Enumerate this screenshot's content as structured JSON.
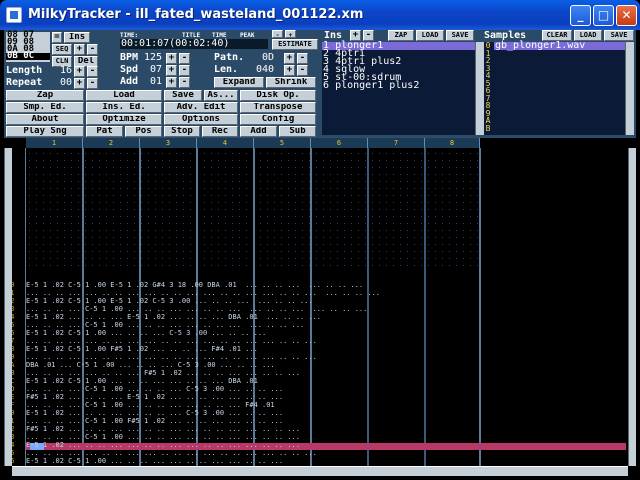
{
  "window": {
    "title": "MilkyTracker - ill_fated_wasteland_001122.xm",
    "minimize": "_",
    "maximize": "□",
    "close": "✕"
  },
  "orderlist": {
    "entries": [
      "08 07",
      "09 08",
      "0A 08",
      "0B 0C"
    ],
    "length_label": "Length",
    "length_value": "16",
    "repeat_label": "Repeat",
    "repeat_value": "00"
  },
  "edit_buttons": {
    "ins": "Ins",
    "seq": "SEQ",
    "clon": "CLN",
    "del": "Del",
    "plus": "+",
    "minus": "-",
    "eq": "="
  },
  "clock": {
    "time_label": "TIME:",
    "title_label": "TITLE",
    "time2_label": "TIME",
    "peak_label": "PEAK",
    "time_value": "00:01:07(00:02:40)",
    "estimate": "ESTIMATE"
  },
  "settings": {
    "bpm_label": "BPM",
    "bpm_value": "125",
    "spd_label": "Spd",
    "spd_value": "07",
    "add_label": "Add",
    "add_value": "01",
    "patn_label": "Patn.",
    "patn_value": "0D",
    "len_label": "Len.",
    "len_value": "040",
    "expand": "Expand",
    "shrink": "Shrink"
  },
  "menu": [
    [
      "Zap",
      "Load",
      "Save",
      "As...",
      "Disk Op."
    ],
    [
      "Smp. Ed.",
      "Ins. Ed.",
      "Adv. Edit",
      "Transpose"
    ],
    [
      "About",
      "Optimize",
      "Options",
      "Config"
    ],
    [
      "Play Sng",
      "Pat",
      "Pos",
      "Stop",
      "Rec",
      "Add",
      "Sub"
    ]
  ],
  "instruments": {
    "header": "Ins",
    "zap": "ZAP",
    "load": "LOAD",
    "save": "SAVE",
    "items": [
      {
        "num": "1",
        "name": "plonger1"
      },
      {
        "num": "2",
        "name": "4ptri"
      },
      {
        "num": "3",
        "name": "4ptri plus2"
      },
      {
        "num": "4",
        "name": "sqlow"
      },
      {
        "num": "5",
        "name": "st-00:sdrum"
      },
      {
        "num": "6",
        "name": "plonger1 plus2"
      }
    ]
  },
  "samples": {
    "header": "Samples",
    "clear": "CLEAR",
    "load": "LOAD",
    "save": "SAVE",
    "hex": [
      "0",
      "1",
      "2",
      "3",
      "4",
      "5",
      "6",
      "7",
      "8",
      "9",
      "A",
      "B"
    ],
    "items": [
      {
        "name": "gb_plonger1.wav"
      }
    ]
  },
  "channels": [
    "1",
    "2",
    "3",
    "4",
    "5",
    "6",
    "7",
    "8"
  ],
  "pattern_rows": [
    {
      "n": "00",
      "text": "E-5 1 .02 C-5 1 .00 E-5 1 .02 G#4 3 18 .00 DBA .01  ... .. .. ...  ... .. .. ... "
    },
    {
      "n": "01",
      "text": "... .. .. ... ... .. .. ... ... .. .. ... ... .. .. ... ... .. .. ...  ... .. .. ... "
    },
    {
      "n": "02",
      "text": "E-5 1 .02 C-5 1 .00 E-5 1 .02 C-5 3 .00 ... .. .. ...  ... .. .. ... "
    },
    {
      "n": "03",
      "text": "... .. .. ... C-5 1 .00 ... .. .. ... ... .. .. ...  ... .. .. ...  ... .. .. ... "
    },
    {
      "n": "04",
      "text": "E-5 1 .02 ... .. .. ... E-5 1 .02 ... .. .. ... DBA .01  ... .. .. ... "
    },
    {
      "n": "05",
      "text": "... .. .. ... C-5 1 .00 ... .. .. ... ... .. .. ...  ... .. .. ... "
    },
    {
      "n": "06",
      "text": "E-5 1 .02 C-5 1 .00 ... .. .. ... C-5 3 .00 ... .. .. ... "
    },
    {
      "n": "07",
      "text": "... .. .. ... ... .. .. ... ... .. .. ... ... .. .. ... ... .. .. ... "
    },
    {
      "n": "08",
      "text": "E-5 1 .02 C-5 1 .00 F#5 1 .02 ... .. .. ... F#4 .01 ... "
    },
    {
      "n": "09",
      "text": "... .. .. ... ... .. .. ... ... .. .. ... ... .. .. ... ... .. .. ... "
    },
    {
      "n": "0A",
      "text": "DBA .01 ... C-5 1 .00 ... .. .. ... C-5 3 .00 ... .. .. ... "
    },
    {
      "n": "0B",
      "text": "... .. .. ... ... .. .. ... F#5 1 .02 ... .. .. ... ... .. .. ... "
    },
    {
      "n": "0C",
      "text": "E-5 1 .02 C-5 1 .00 ... .. .. ... ... .. .. ... DBA .01 "
    },
    {
      "n": "0D",
      "text": "... .. .. ... C-5 1 .00 ... .. .. ... C-5 3 .00 ... .. .. ... "
    },
    {
      "n": "0E",
      "text": "F#5 1 .02 ... .. .. ... E-5 1 .02 ... .. .. ... ... .. .. ... "
    },
    {
      "n": "0F",
      "text": "... .. .. ... C-5 1 .00 ... .. .. ... ... .. .. ... F#4 .01 "
    },
    {
      "n": "10",
      "text": "E-5 1 .02 ... .. .. ... ... .. .. ... C-5 3 .00 ... .. .. ... "
    },
    {
      "n": "11",
      "text": "... .. .. ... C-5 1 .00 F#5 1 .02 ... .. .. ... ... .. .. ... "
    },
    {
      "n": "12",
      "text": "F#5 1 .02 ... .. .. ... ... .. .. ... ... .. .. ... ... .. .. ... "
    },
    {
      "n": "13",
      "text": "... .. .. ... C-5 1 .00 ... .. .. ... ... .. .. ... ... .. .. ... "
    },
    {
      "n": "14",
      "text": "E-5 1 .02 ... .. .. ... ... .. .. ... ... .. .. ... ... .. .. ... "
    },
    {
      "n": "15",
      "text": "... .. .. ... ... .. .. ... ... .. .. ... ... .. .. ... ... .. .. ... "
    },
    {
      "n": "16",
      "text": "E-5 1 .02 C-5 1 .00 ... .. .. ... ... .. .. ... ... .. .. ... "
    }
  ]
}
